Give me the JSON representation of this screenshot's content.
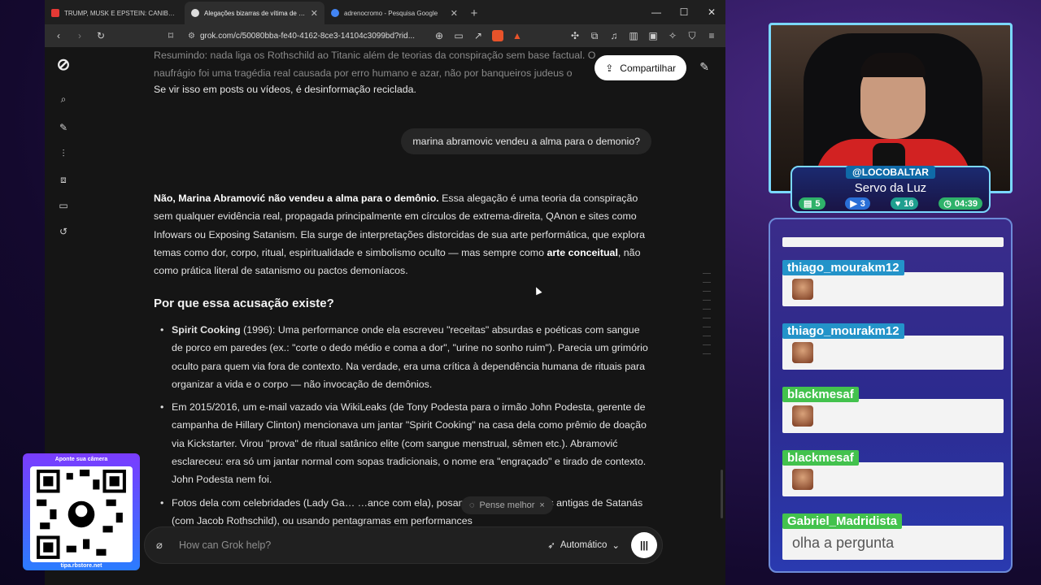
{
  "browser": {
    "tabs": [
      {
        "title": "TRUMP, MUSK E EPSTEIN: CANIBALISMO",
        "icon_color": "#e53935",
        "active": false
      },
      {
        "title": "Alegações bizarras de vítima de Epstein",
        "icon_color": "#dddddd",
        "active": true
      },
      {
        "title": "adrenocromo - Pesquisa Google",
        "icon_color": "#4285f4",
        "active": false
      }
    ],
    "url": "grok.com/c/50080bba-fe40-4162-8ce3-14104c3099bd?rid..."
  },
  "grok": {
    "share_label": "Compartilhar",
    "faded_text_1": "Resumindo: nada liga os Rothschild ao Titanic além de teorias da conspiração sem base factual. O",
    "faded_text_2": "naufrágio foi uma tragédia real causada por erro humano e azar, não por banqueiros judeus o",
    "prev_line": "Se vir isso em posts ou vídeos, é desinformação reciclada.",
    "user_question": "marina abramovic vendeu a alma para o demonio?",
    "answer_bold": "Não, Marina Abramović não vendeu a alma para o demônio.",
    "answer_rest_1": " Essa alegação é uma teoria da conspiração sem qualquer evidência real, propagada principalmente em círculos de extrema-direita, QAnon e sites como Infowars ou Exposing Satanism. Ela surge de interpretações distorcidas de sua arte performática, que explora temas como dor, corpo, ritual, espiritualidade e simbolismo oculto — mas sempre como ",
    "answer_bold_2": "arte conceitual",
    "answer_rest_2": ", não como prática literal de satanismo ou pactos demoníacos.",
    "heading": "Por que essa acusação existe?",
    "bullets": [
      {
        "bold": "Spirit Cooking",
        "text": " (1996): Uma performance onde ela escreveu \"receitas\" absurdas e poéticas com sangue de porco em paredes (ex.: \"corte o dedo médio e coma a dor\", \"urine no sonho ruim\"). Parecia um grimório oculto para quem via fora de contexto. Na verdade, era uma crítica à dependência humana de rituais para organizar a vida e o corpo — não invocação de demônios."
      },
      {
        "bold": "",
        "text": "Em 2015/2016, um e-mail vazado via WikiLeaks (de Tony Podesta para o irmão John Podesta, gerente de campanha de Hillary Clinton) mencionava um jantar \"Spirit Cooking\" na casa dela como prêmio de doação via Kickstarter. Virou \"prova\" de ritual satânico elite (com sangue menstrual, sêmen etc.). Abramović esclareceu: era só um jantar normal com sopas tradicionais, o nome era \"engraçado\" e tirado de contexto. John Podesta nem foi."
      },
      {
        "bold": "",
        "text": "Fotos dela com celebridades (Lady Ga… …ance com ela), posando perto de pinturas antigas de Satanás (com Jacob Rothschild), ou usando pentagramas em performances"
      }
    ],
    "think_chip": "Pense melhor",
    "composer_placeholder": "How can Grok help?",
    "mode_label": "Automático"
  },
  "overlay": {
    "qr_title": "Aponte sua câmera",
    "qr_url": "tipa.rbstore.net",
    "handle": "@LOCOBALTAR",
    "title": "Servo da Luz",
    "stats": [
      "5",
      "3",
      "16",
      "04:39"
    ],
    "chat": [
      {
        "user": "thiago_mourakm12",
        "body": ""
      },
      {
        "user": "thiago_mourakm12",
        "body": ""
      },
      {
        "user": "blackmesaf",
        "body": ""
      },
      {
        "user": "blackmesaf",
        "body": ""
      },
      {
        "user": "Gabriel_Madridista",
        "body": "olha a pergunta"
      }
    ]
  }
}
